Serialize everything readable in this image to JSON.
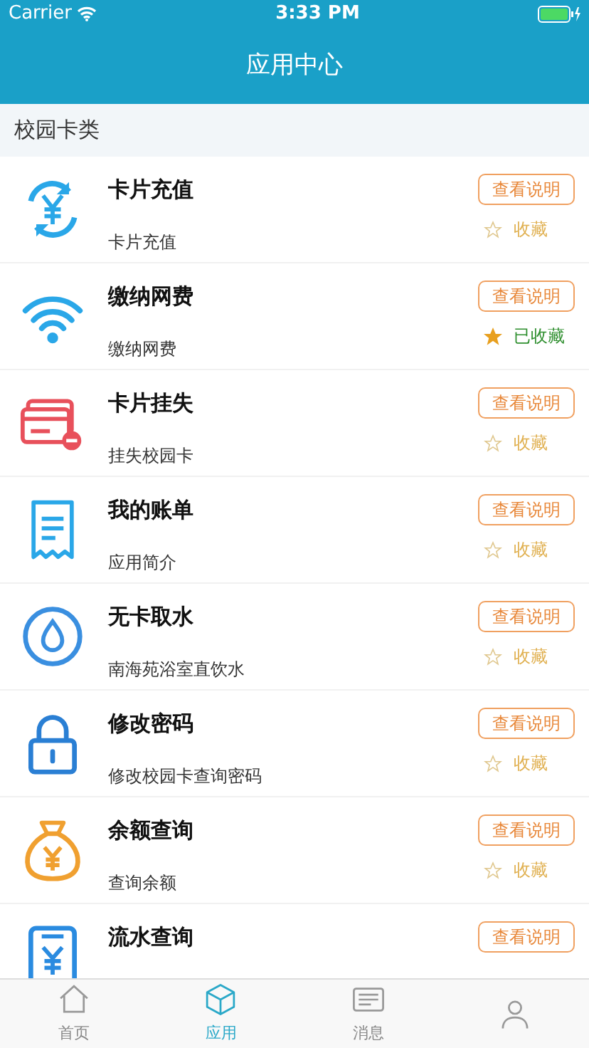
{
  "status_bar": {
    "carrier": "Carrier",
    "time": "3:33 PM"
  },
  "title": "应用中心",
  "section": "校园卡类",
  "apps": [
    {
      "kind": "recharge",
      "title": "卡片充值",
      "subtitle": "卡片充值",
      "button": "查看说明",
      "favorite": false,
      "favorite_label": "收藏"
    },
    {
      "kind": "wifi",
      "title": "缴纳网费",
      "subtitle": "缴纳网费",
      "button": "查看说明",
      "favorite": true,
      "favorite_label": "已收藏"
    },
    {
      "kind": "card",
      "title": "卡片挂失",
      "subtitle": "挂失校园卡",
      "button": "查看说明",
      "favorite": false,
      "favorite_label": "收藏"
    },
    {
      "kind": "bill",
      "title": "我的账单",
      "subtitle": "应用简介",
      "button": "查看说明",
      "favorite": false,
      "favorite_label": "收藏"
    },
    {
      "kind": "water",
      "title": "无卡取水",
      "subtitle": "南海苑浴室直饮水",
      "button": "查看说明",
      "favorite": false,
      "favorite_label": "收藏"
    },
    {
      "kind": "lock",
      "title": "修改密码",
      "subtitle": "修改校园卡查询密码",
      "button": "查看说明",
      "favorite": false,
      "favorite_label": "收藏"
    },
    {
      "kind": "bag",
      "title": "余额查询",
      "subtitle": "查询余额",
      "button": "查看说明",
      "favorite": false,
      "favorite_label": "收藏"
    },
    {
      "kind": "receipt",
      "title": "流水查询",
      "button": "查看说明"
    }
  ],
  "tabs": [
    {
      "kind": "home",
      "label": "首页",
      "selected": false
    },
    {
      "kind": "apps",
      "label": "应用",
      "selected": true
    },
    {
      "kind": "news",
      "label": "消息",
      "selected": false
    },
    {
      "kind": "person",
      "selected": false
    }
  ]
}
